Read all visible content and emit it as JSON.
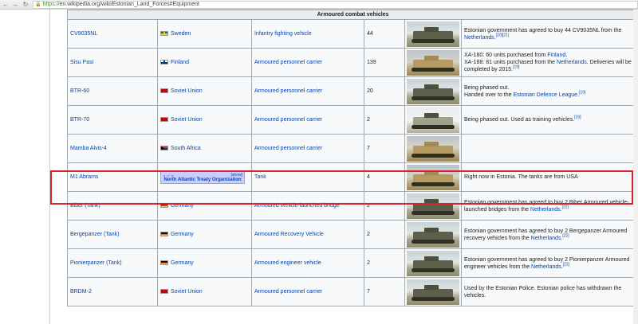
{
  "browser": {
    "url_scheme": "https://",
    "url_rest": "en.wikipedia.org/wiki/Estonian_Land_Forces#Equipment"
  },
  "table": {
    "header": "Armoured combat vehicles",
    "rows": [
      {
        "name": "CV9035NL",
        "origin": "Sweden",
        "flag": "se",
        "type": "Infantry fighting vehicle",
        "quantity": "44",
        "notes": [
          {
            "text": "Estonian government has agreed to buy 44 CV9035NL from the ",
            "link": "Netherlands",
            "after": ".",
            "refs": "[20][21]"
          }
        ]
      },
      {
        "name": "Sisu Pasi",
        "origin": "Finland",
        "flag": "fi",
        "type": "Armoured personnel carrier",
        "quantity": "139",
        "notes": [
          {
            "text": "XA-180: 60 units purchased from ",
            "link": "Finland",
            "after": ".",
            "refs": ""
          },
          {
            "text": "XA-188: 81 units purchased from the ",
            "link": "Netherlands",
            "after": ". Deliveries will be completed by 2015.",
            "refs": "[19]"
          }
        ]
      },
      {
        "name": "BTR-60",
        "origin": "Soviet Union",
        "flag": "su",
        "type": "Armoured personnel carrier",
        "quantity": "20",
        "notes": [
          {
            "text": "Being phased out.",
            "link": "",
            "after": "",
            "refs": ""
          },
          {
            "text": "Handed over to the ",
            "link": "Estonian Defence League",
            "after": ".",
            "refs": "[19]"
          }
        ]
      },
      {
        "name": "BTR-70",
        "origin": "Soviet Union",
        "flag": "su",
        "type": "Armoured personnel carrier",
        "quantity": "2",
        "notes": [
          {
            "text": "Being phased out. Used as training vehicles.",
            "link": "",
            "after": "",
            "refs": "[19]"
          }
        ]
      },
      {
        "name": "Mamba Alvis-4",
        "origin": "South Africa",
        "flag": "za",
        "type": "Armoured personnel carrier",
        "quantity": "7",
        "notes": []
      },
      {
        "name": "M1 Abrams",
        "origin": "",
        "flag": "",
        "navbox": {
          "vte": "v · t · e",
          "show": "[show]",
          "title": "North Atlantic Treaty Organization"
        },
        "type": "Tank",
        "quantity": "4",
        "notes": [
          {
            "text": "Right now in Estonia. The tanks are from USA",
            "link": "",
            "after": "",
            "refs": ""
          }
        ]
      },
      {
        "name": "Biber (Tank)",
        "origin": "Germany",
        "flag": "de",
        "type": "Armoured vehicle-launched bridge",
        "quantity": "2",
        "notes": [
          {
            "text": "Estonian government has agreed to buy 2 Biber Armoured vehicle-launched bridges from the ",
            "link": "Netherlands",
            "after": ".",
            "refs": "[22]"
          }
        ]
      },
      {
        "name": "Bergepanzer (Tank)",
        "origin": "Germany",
        "flag": "de",
        "type": "Armoured Recovery Vehicle",
        "quantity": "2",
        "notes": [
          {
            "text": "Estonian government has agreed to buy 2 Bergepanzer Armoured recovery vehicles from the ",
            "link": "Netherlands",
            "after": ".",
            "refs": "[22]"
          }
        ]
      },
      {
        "name": "Pionierpanzer (Tank)",
        "origin": "Germany",
        "flag": "de",
        "type": "Armoured engineer vehicle",
        "quantity": "2",
        "notes": [
          {
            "text": "Estonian government has agreed to buy 2 Pionierpanzer Armoured engineer vehicles from the ",
            "link": "Netherlands",
            "after": ".",
            "refs": "[22]"
          }
        ]
      },
      {
        "name": "BRDM-2",
        "origin": "Soviet Union",
        "flag": "su",
        "type": "Armoured personnel carrier",
        "quantity": "7",
        "notes": [
          {
            "text": "Used by the Estonian Police. Estonian police has withdrawn the vehicles.",
            "link": "",
            "after": "",
            "refs": ""
          }
        ]
      }
    ]
  },
  "colors": {
    "link": "#0645ad",
    "highlight": "#d9222a"
  }
}
